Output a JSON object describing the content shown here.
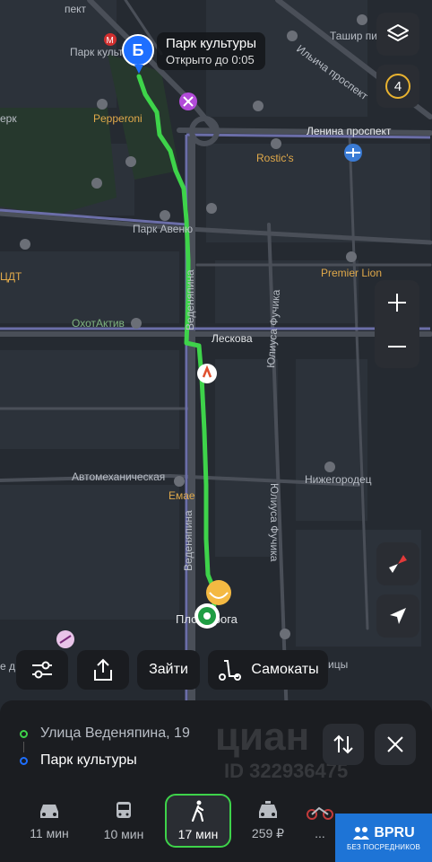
{
  "map": {
    "labels": {
      "prospekt_top": "пект",
      "park_kultury_metro": "Парк культу",
      "pepperoni": "Pepperoni",
      "perk": "ерк",
      "tashir": "Ташир пи",
      "ilicha_prospekt": "Ильича проспект",
      "lenina_prospekt": "Ленина проспект",
      "rostics": "Rostic's",
      "park_avenue": "Парк Авеню",
      "premier_lion": "Premier Lion",
      "tsdt": "ЦДТ",
      "ohotaktiv": "ОхотАктив",
      "leskova": "Лескова",
      "venyapina_1": "Веденяпина",
      "yuliusa_fuchika_1": "Юлиуса Фучика",
      "avtomehanicheskaya": "Автомеханическая",
      "emae": "Емае",
      "nizhegorodets": "Нижегородец",
      "venyapina_2": "Веденяпина",
      "yuliusa_fuchika_2": "Юлиуса Фучика",
      "ploschad_doroga": "Пло   дорога",
      "tsy": "ицы",
      "de": "е д"
    },
    "destination": {
      "pin_letter": "Б",
      "name": "Парк культуры",
      "hours": "Открыто до 0:05"
    },
    "layers_counter": "4",
    "route_color": "#3ed34a"
  },
  "chips": {
    "enter": "Зайти",
    "scooters": "Самокаты"
  },
  "route": {
    "from": "Улица Веденяпина, 19",
    "to": "Парк культуры"
  },
  "modes": [
    {
      "icon": "car-icon",
      "label": "11 мин"
    },
    {
      "icon": "bus-icon",
      "label": "10 мин"
    },
    {
      "icon": "walk-icon",
      "label": "17 мин"
    },
    {
      "icon": "taxi-icon",
      "label": "259 ₽"
    },
    {
      "icon": "moto-icon",
      "label": "..."
    }
  ],
  "watermark": {
    "brand": "циан",
    "id": "ID 322936475"
  },
  "badge": {
    "title": "BPRU",
    "subtitle": "БЕЗ ПОСРЕДНИКОВ"
  },
  "colors": {
    "accent_green": "#3ed34a",
    "pin_blue": "#1e6fff",
    "counter_yellow": "#e8b230",
    "badge_blue": "#1e74d6"
  }
}
